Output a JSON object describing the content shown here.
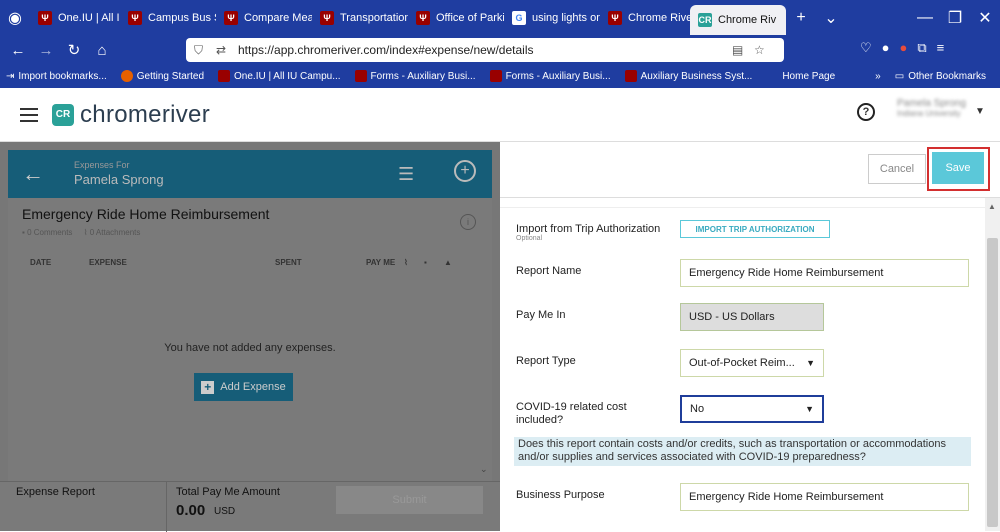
{
  "browser": {
    "tabs": [
      {
        "label": "One.IU | All IU"
      },
      {
        "label": "Campus Bus Se"
      },
      {
        "label": "Compare Meal"
      },
      {
        "label": "Transportation"
      },
      {
        "label": "Office of Parkin"
      },
      {
        "label": "using lights on"
      },
      {
        "label": "Chrome River T"
      },
      {
        "label": "Chrome Riv"
      }
    ],
    "new_tab": "+",
    "url": "https://app.chromeriver.com/index#expense/new/details",
    "bookmarks": [
      {
        "label": "Import bookmarks..."
      },
      {
        "label": "Getting Started"
      },
      {
        "label": "One.IU | All IU Campu..."
      },
      {
        "label": "Forms - Auxiliary Busi..."
      },
      {
        "label": "Forms - Auxiliary Busi..."
      },
      {
        "label": "Auxiliary Business Syst..."
      },
      {
        "label": "Home Page"
      }
    ],
    "other_bookmarks": "Other Bookmarks"
  },
  "app": {
    "logo_text": "chromeriver",
    "logo_mark": "CR",
    "user_name": "Pamela Sprong",
    "user_org": "Indiana University"
  },
  "left": {
    "expenses_for_label": "Expenses For",
    "expenses_for_name": "Pamela Sprong",
    "report_title": "Emergency Ride Home Reimbursement",
    "comments": "0 Comments",
    "attachments": "0 Attachments",
    "columns": {
      "date": "DATE",
      "expense": "EXPENSE",
      "spent": "SPENT",
      "pay_me": "PAY ME"
    },
    "empty_message": "You have not added any expenses.",
    "add_expense": "Add Expense",
    "footer": {
      "expense_report": "Expense Report",
      "total_label": "Total Pay Me Amount",
      "total_amount": "0.00",
      "currency": "USD",
      "submit": "Submit"
    }
  },
  "right": {
    "cancel": "Cancel",
    "save": "Save",
    "import_label": "Import from Trip Authorization",
    "import_optional": "Optional",
    "import_button": "IMPORT TRIP AUTHORIZATION",
    "report_name_label": "Report Name",
    "report_name_value": "Emergency Ride Home Reimbursement",
    "pay_me_in_label": "Pay Me In",
    "pay_me_in_value": "USD - US Dollars",
    "report_type_label": "Report Type",
    "report_type_value": "Out-of-Pocket Reim...",
    "covid_label_line1": "COVID-19 related cost",
    "covid_label_line2": "included?",
    "covid_value": "No",
    "covid_note": "Does this report contain costs and/or credits, such as transportation or accommodations and/or supplies and services associated with COVID-19 preparedness?",
    "business_purpose_label": "Business Purpose",
    "business_purpose_value": "Emergency Ride Home Reimbursement"
  }
}
